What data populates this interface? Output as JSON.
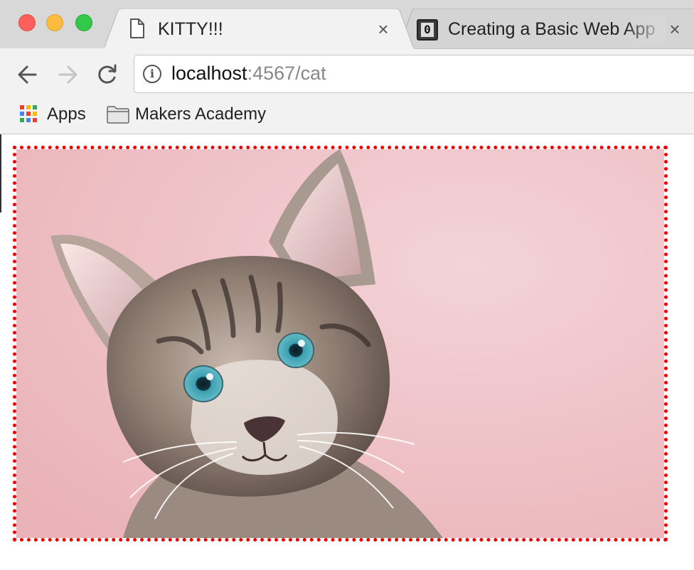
{
  "window": {
    "traffic_lights": [
      "close",
      "minimize",
      "maximize"
    ]
  },
  "tabs": [
    {
      "title": "KITTY!!!",
      "active": true,
      "icon": "page-icon"
    },
    {
      "title": "Creating a Basic Web App",
      "active": false,
      "icon": "site-favicon",
      "icon_text": "0"
    }
  ],
  "toolbar": {
    "url_host": "localhost",
    "url_rest": ":4567/cat",
    "info_icon": "i"
  },
  "bookmarks": [
    {
      "label": "Apps",
      "icon": "apps-grid-icon"
    },
    {
      "label": "Makers Academy",
      "icon": "folder-icon"
    }
  ],
  "content": {
    "image_subject": "kitten",
    "border_color": "#ee0000",
    "border_style": "dotted"
  },
  "colors": {
    "tabstrip": "#d8d8d8",
    "toolbar": "#f2f2f2",
    "image_background": "#f1c9cf"
  }
}
